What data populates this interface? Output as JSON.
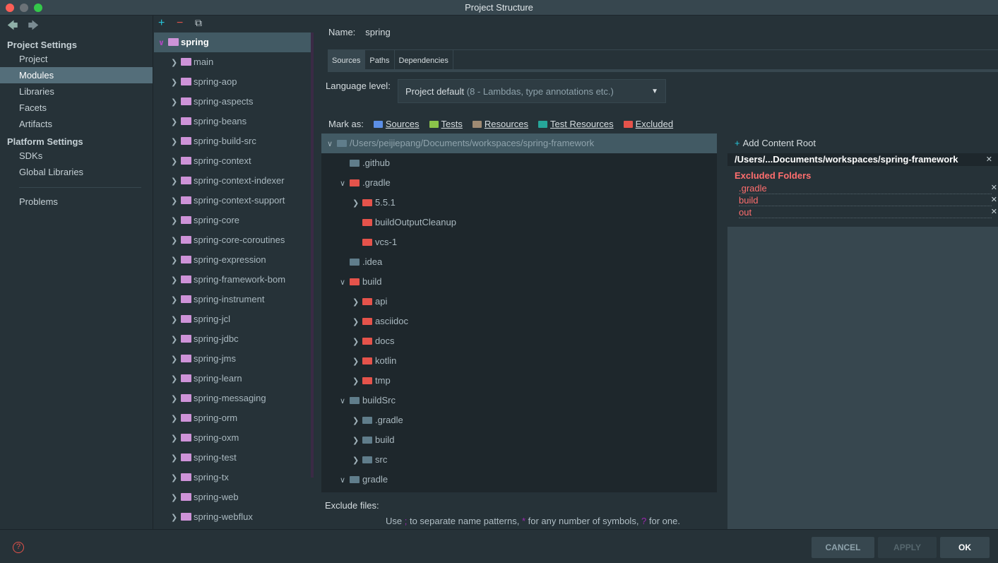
{
  "window": {
    "title": "Project Structure"
  },
  "nav": {
    "project_settings_label": "Project Settings",
    "project_settings": [
      "Project",
      "Modules",
      "Libraries",
      "Facets",
      "Artifacts"
    ],
    "platform_settings_label": "Platform Settings",
    "platform_settings": [
      "SDKs",
      "Global Libraries"
    ],
    "problems": "Problems",
    "selected": "Modules"
  },
  "modules": {
    "root": "spring",
    "items": [
      "main",
      "spring-aop",
      "spring-aspects",
      "spring-beans",
      "spring-build-src",
      "spring-context",
      "spring-context-indexer",
      "spring-context-support",
      "spring-core",
      "spring-core-coroutines",
      "spring-expression",
      "spring-framework-bom",
      "spring-instrument",
      "spring-jcl",
      "spring-jdbc",
      "spring-jms",
      "spring-learn",
      "spring-messaging",
      "spring-orm",
      "spring-oxm",
      "spring-test",
      "spring-tx",
      "spring-web",
      "spring-webflux"
    ]
  },
  "detail": {
    "name_label": "Name:",
    "name_value": "spring",
    "tabs": [
      "Sources",
      "Paths",
      "Dependencies"
    ],
    "language_label": "Language level:",
    "language_value": "Project default",
    "language_hint": "(8 - Lambdas, type annotations etc.)",
    "mark_as_label": "Mark as:",
    "mark_as": [
      {
        "label": "Sources",
        "color": "#5c8fe6"
      },
      {
        "label": "Tests",
        "color": "#8bc34a"
      },
      {
        "label": "Resources",
        "color": "#9e8a73"
      },
      {
        "label": "Test Resources",
        "color": "#26a69a"
      },
      {
        "label": "Excluded",
        "color": "#e5534b"
      }
    ],
    "tree": [
      {
        "label": "/Users/peijiepang/Documents/workspaces/spring-framework",
        "indent": 0,
        "chev": "v",
        "color": "#607d8b",
        "selected": true
      },
      {
        "label": ".github",
        "indent": 1,
        "chev": "",
        "color": "#607d8b"
      },
      {
        "label": ".gradle",
        "indent": 1,
        "chev": "v",
        "color": "#e5534b"
      },
      {
        "label": "5.5.1",
        "indent": 2,
        "chev": ">",
        "color": "#e5534b"
      },
      {
        "label": "buildOutputCleanup",
        "indent": 2,
        "chev": "",
        "color": "#e5534b"
      },
      {
        "label": "vcs-1",
        "indent": 2,
        "chev": "",
        "color": "#e5534b"
      },
      {
        "label": ".idea",
        "indent": 1,
        "chev": "",
        "color": "#607d8b"
      },
      {
        "label": "build",
        "indent": 1,
        "chev": "v",
        "color": "#e5534b"
      },
      {
        "label": "api",
        "indent": 2,
        "chev": ">",
        "color": "#e5534b"
      },
      {
        "label": "asciidoc",
        "indent": 2,
        "chev": ">",
        "color": "#e5534b"
      },
      {
        "label": "docs",
        "indent": 2,
        "chev": ">",
        "color": "#e5534b"
      },
      {
        "label": "kotlin",
        "indent": 2,
        "chev": ">",
        "color": "#e5534b"
      },
      {
        "label": "tmp",
        "indent": 2,
        "chev": ">",
        "color": "#e5534b"
      },
      {
        "label": "buildSrc",
        "indent": 1,
        "chev": "v",
        "color": "#607d8b"
      },
      {
        "label": ".gradle",
        "indent": 2,
        "chev": ">",
        "color": "#607d8b"
      },
      {
        "label": "build",
        "indent": 2,
        "chev": ">",
        "color": "#607d8b"
      },
      {
        "label": "src",
        "indent": 2,
        "chev": ">",
        "color": "#607d8b"
      },
      {
        "label": "gradle",
        "indent": 1,
        "chev": "v",
        "color": "#607d8b"
      }
    ],
    "exclude_files_label": "Exclude files:",
    "hint_parts": [
      "Use ",
      ";",
      " to separate name patterns, ",
      "*",
      " for any number of symbols, ",
      "?",
      " for one."
    ]
  },
  "content_root": {
    "add_label": "Add Content Root",
    "path": "/Users/...Documents/workspaces/spring-framework",
    "excluded_header": "Excluded Folders",
    "excluded": [
      ".gradle",
      "build",
      "out"
    ]
  },
  "footer": {
    "cancel": "CANCEL",
    "apply": "APPLY",
    "ok": "OK"
  }
}
